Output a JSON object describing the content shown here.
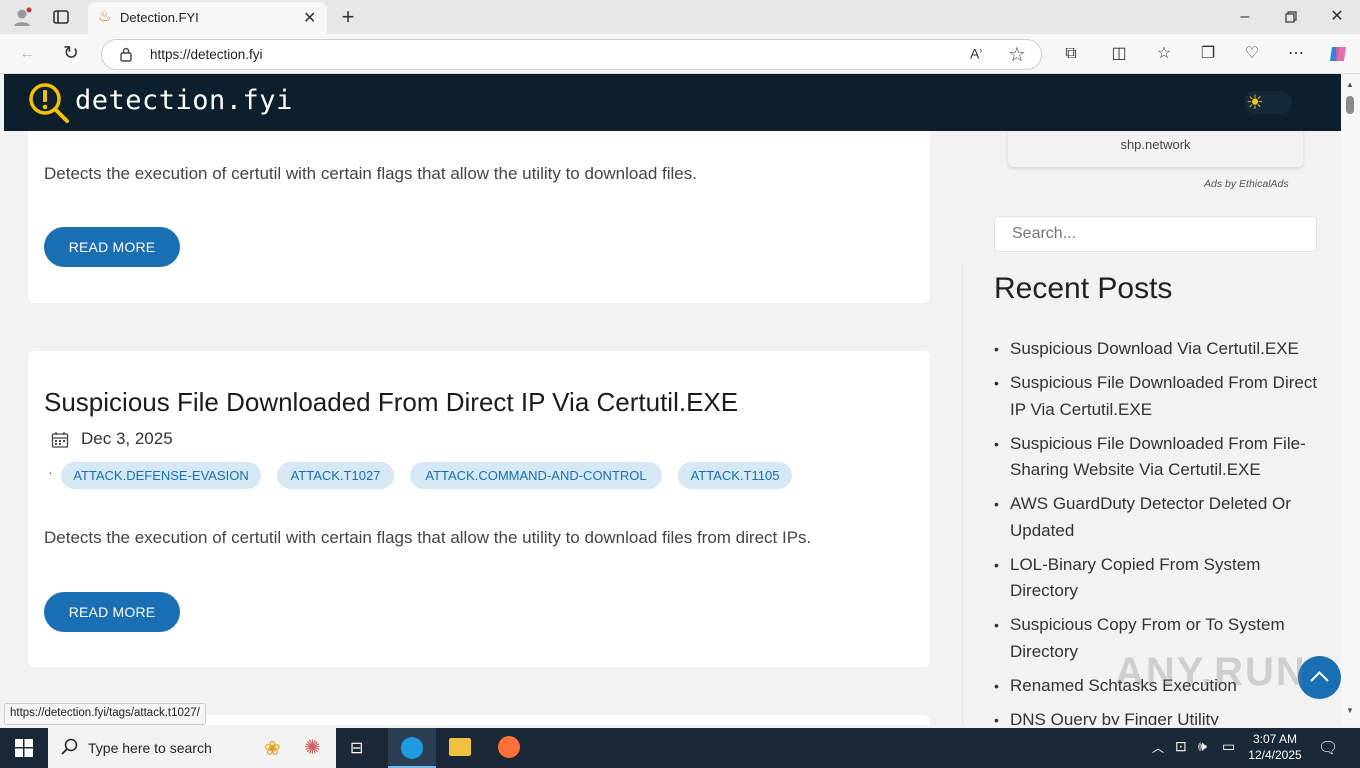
{
  "browser": {
    "tab_title": "Detection.FYI",
    "url": "https://detection.fyi",
    "status_url": "https://detection.fyi/tags/attack.t1027/"
  },
  "site": {
    "logo_text": "detection.fyi",
    "header_bg": "#0d1f2d",
    "accent": "#1a6fb3"
  },
  "posts": [
    {
      "description": "Detects the execution of certutil with certain flags that allow the utility to download files.",
      "read_more": "READ MORE"
    },
    {
      "title": "Suspicious File Downloaded From Direct IP Via Certutil.EXE",
      "date": "Dec 3, 2025",
      "tags_separator": "·",
      "tags": [
        "ATTACK.DEFENSE-EVASION",
        "ATTACK.T1027",
        "ATTACK.COMMAND-AND-CONTROL",
        "ATTACK.T1105"
      ],
      "description": "Detects the execution of certutil with certain flags that allow the utility to download files from direct IPs.",
      "read_more": "READ MORE"
    }
  ],
  "sidebar": {
    "ad_domain": "shp.network",
    "ad_label": "Ads by EthicalAds",
    "search_placeholder": "Search...",
    "recent_title": "Recent Posts",
    "recent_posts": [
      "Suspicious Download Via Certutil.EXE",
      "Suspicious File Downloaded From Direct IP Via Certutil.EXE",
      "Suspicious File Downloaded From File-Sharing Website Via Certutil.EXE",
      "AWS GuardDuty Detector Deleted Or Updated",
      "LOL-Binary Copied From System Directory",
      "Suspicious Copy From or To System Directory",
      "Renamed Schtasks Execution",
      "DNS Query by Finger Utility"
    ]
  },
  "taskbar": {
    "search_placeholder": "Type here to search",
    "time": "3:07 AM",
    "date": "12/4/2025"
  },
  "watermark": "ANY.RUN"
}
